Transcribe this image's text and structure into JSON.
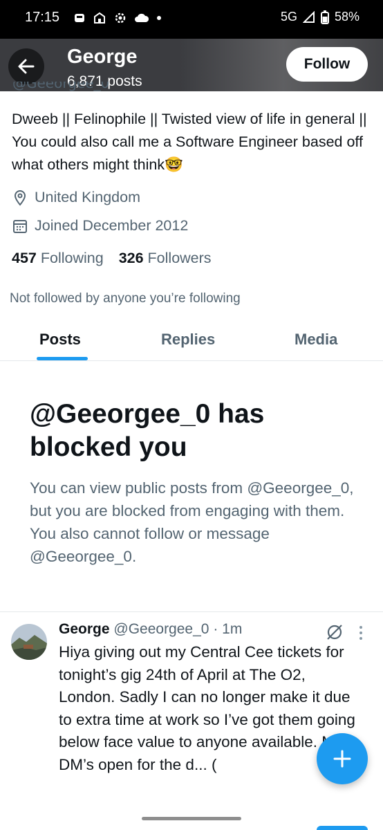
{
  "status_bar": {
    "time": "17:15",
    "network": "5G",
    "battery": "58%",
    "icons": [
      "sim-card-icon",
      "notification-icon",
      "settings-icon",
      "cloud-icon",
      "dot-icon",
      "signal-icon",
      "battery-icon"
    ]
  },
  "header": {
    "name": "George",
    "posts_count": "6,871 posts",
    "follow_label": "Follow"
  },
  "profile": {
    "handle_cut": "@Geeorgee_0",
    "bio": "Dweeb || Felinophile || Twisted view of life in general || You could also call me a Software Engineer based off what others might think🤓",
    "location": "United Kingdom",
    "joined": "Joined December 2012",
    "following_count": "457",
    "following_label": "Following",
    "followers_count": "326",
    "followers_label": "Followers",
    "not_followed_text": "Not followed by anyone you’re following"
  },
  "tabs": [
    {
      "label": "Posts",
      "active": true
    },
    {
      "label": "Replies",
      "active": false
    },
    {
      "label": "Media",
      "active": false
    }
  ],
  "blocked": {
    "title": "@Geeorgee_0 has blocked you",
    "description": "You can view public posts from @Geeorgee_0, but you are blocked from engaging with them. You also cannot follow or message @Geeorgee_0."
  },
  "post": {
    "author": "George",
    "handle": "@Geeorgee_0",
    "separator": "·",
    "time": "1m",
    "text": "Hiya giving out my Central Cee tickets for tonight’s gig 24th of April at The O2, London. Sadly I can no longer make it due to extra time at work so I’ve got them going below face value to anyone available. My DM’s open for the d... ("
  },
  "colors": {
    "accent": "#1d9bf0",
    "text_primary": "#0f1419",
    "text_secondary": "#536471",
    "header_bg": "#3b3c40"
  }
}
